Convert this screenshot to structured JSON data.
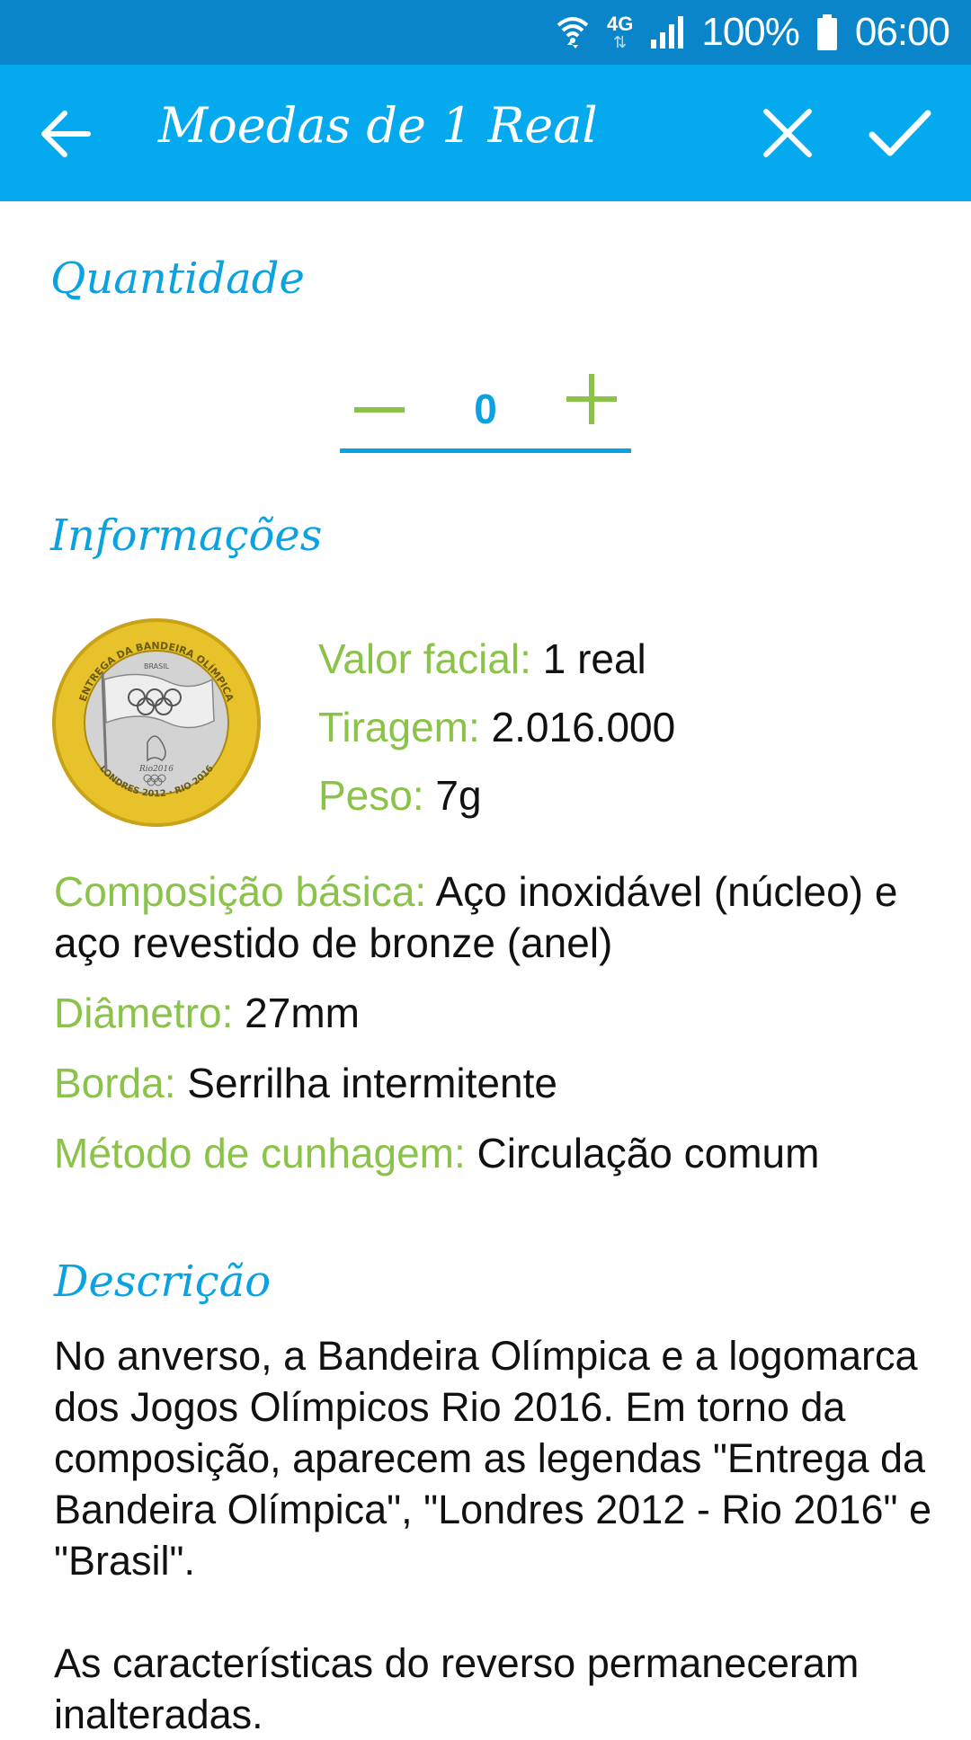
{
  "status_bar": {
    "network_type": "4G",
    "battery": "100%",
    "time": "06:00"
  },
  "app_bar": {
    "title": "Moedas de 1 Real"
  },
  "quantity": {
    "section_title": "Quantidade",
    "value": "0"
  },
  "info": {
    "section_title": "Informações",
    "facial_value_label": "Valor facial:",
    "facial_value": " 1 real",
    "mintage_label": "Tiragem:",
    "mintage": " 2.016.000",
    "weight_label": "Peso:",
    "weight": " 7g",
    "composition_label": "Composição básica:",
    "composition": " Aço inoxidável (núcleo) e aço revestido de bronze (anel)",
    "diameter_label": "Diâmetro:",
    "diameter": " 27mm",
    "edge_label": "Borda:",
    "edge": " Serrilha intermitente",
    "minting_label": "Método de cunhagem:",
    "minting": " Circulação comum"
  },
  "coin_image": {
    "top_text": "ENTREGA DA BANDEIRA OLÍMPICA",
    "country": "BRASIL",
    "bottom_text": "LONDRES 2012 · RIO 2016",
    "logo_text": "Rio2016"
  },
  "description": {
    "section_title": "Descrição",
    "text": "No anverso, a Bandeira Olímpica e a logomarca dos Jogos Olímpicos Rio 2016. Em torno da composição, aparecem as legendas \"Entrega da Bandeira Olímpica\", \"Londres 2012 - Rio 2016\" e \"Brasil\".\n\nAs características do reverso permaneceram inalteradas."
  },
  "colors": {
    "status_bar": "#0a85c9",
    "app_bar": "#04a9ee",
    "accent_blue": "#0aa2e0",
    "label_green": "#8bc34a",
    "coin_gold": "#e8c22a",
    "coin_silver": "#d3d3d3"
  },
  "icons": {
    "back": "arrow-left-icon",
    "close": "close-icon",
    "confirm": "check-icon",
    "minus": "minus-icon",
    "plus": "plus-icon",
    "wifi": "wifi-icon",
    "signal": "signal-icon",
    "battery": "battery-icon"
  }
}
